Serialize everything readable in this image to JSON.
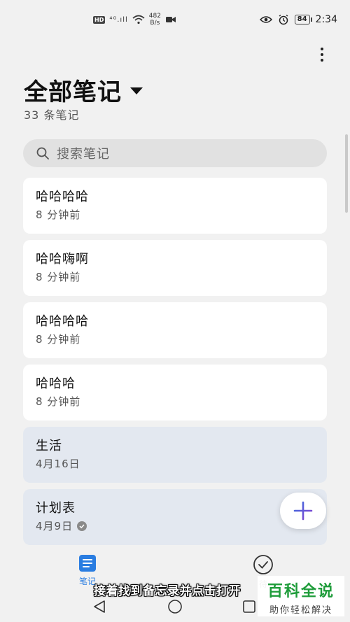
{
  "status_bar": {
    "hd": "HD",
    "signal": "⁴ᴳ.ıll",
    "net_rate_top": "482",
    "net_rate_bottom": "B/s",
    "battery": "84",
    "time": "2:34"
  },
  "header": {
    "title": "全部笔记",
    "count": "33 条笔记"
  },
  "search": {
    "placeholder": "搜索笔记"
  },
  "notes": [
    {
      "title": "哈哈哈哈",
      "time": "8 分钟前"
    },
    {
      "title": "哈哈嗨啊",
      "time": "8 分钟前"
    },
    {
      "title": "哈哈哈哈",
      "time": "8 分钟前"
    },
    {
      "title": "哈哈哈",
      "time": "8 分钟前"
    },
    {
      "title": "生活",
      "time": "4月16日"
    },
    {
      "title": "计划表",
      "time": "4月9日"
    }
  ],
  "bottom_nav": {
    "notes_label": "笔记",
    "todo_label": "待"
  },
  "caption": "接着找到备忘录并点击打开",
  "watermark": {
    "title": "百科全说",
    "subtitle": "助你轻松解决"
  },
  "colors": {
    "accent": "#2a7de1",
    "fab_plus": "#6a4bd8",
    "watermark_green": "#1e9c3a"
  }
}
